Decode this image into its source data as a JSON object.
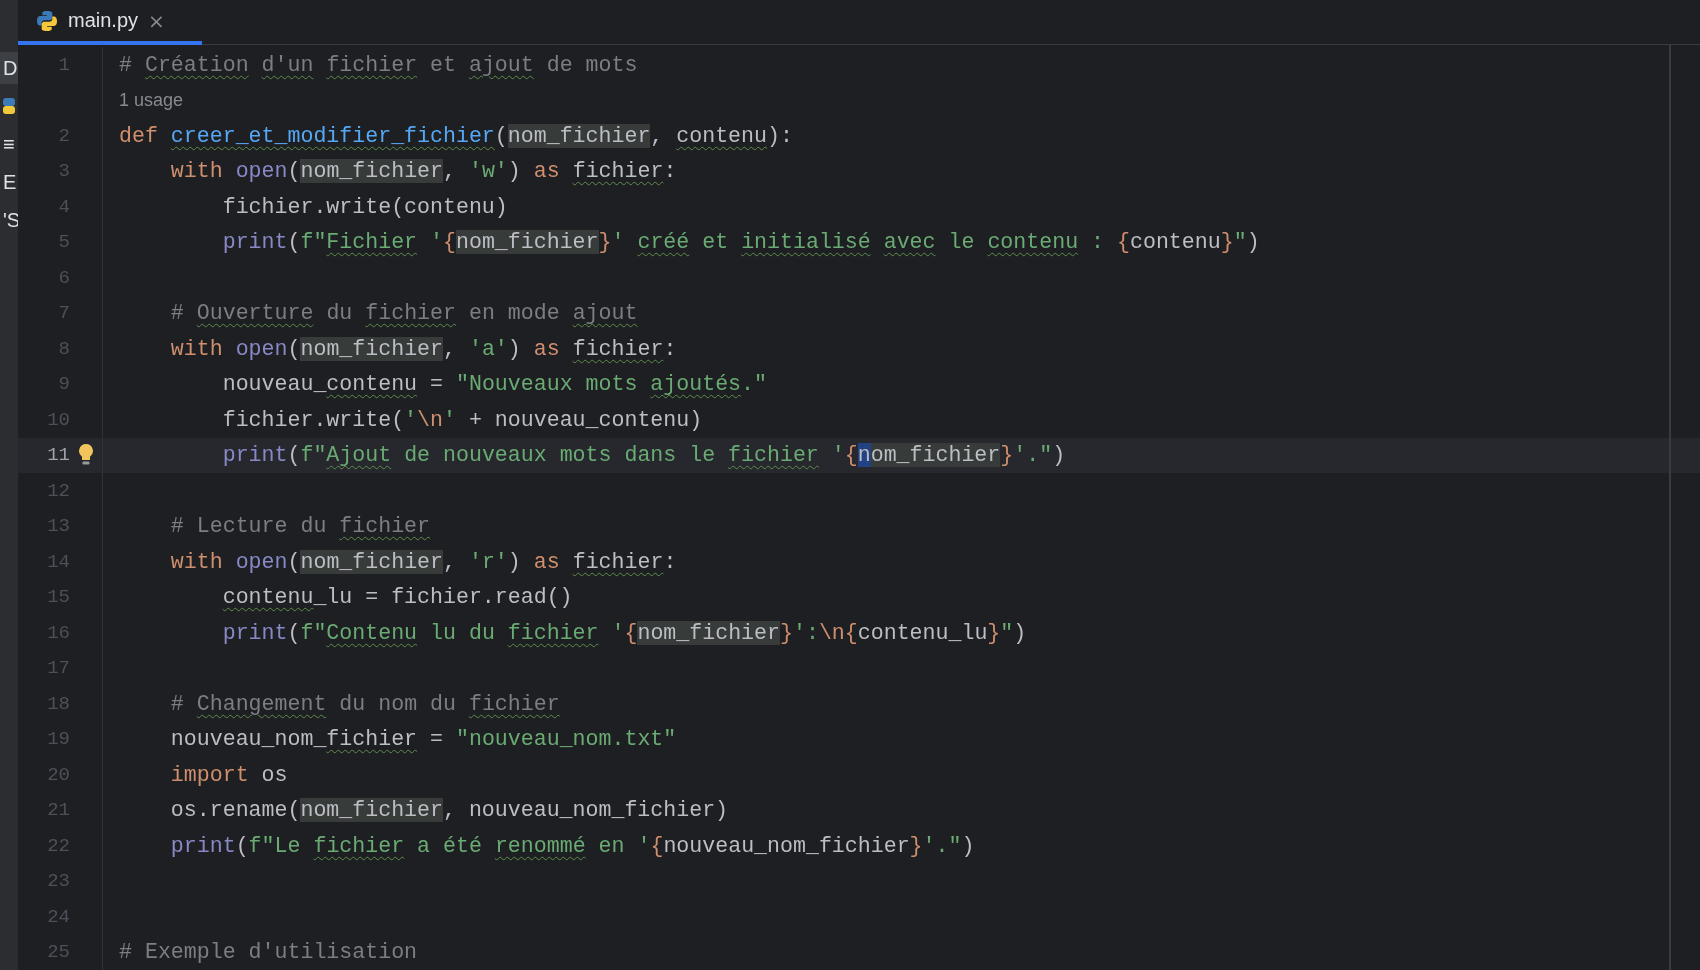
{
  "side_strip": [
    {
      "kind": "text",
      "text": "D",
      "selected": true
    },
    {
      "kind": "python-icon",
      "selected": false
    },
    {
      "kind": "text",
      "text": "≡",
      "selected": false
    },
    {
      "kind": "text",
      "text": "E",
      "selected": false
    },
    {
      "kind": "text",
      "text": "'S",
      "selected": false
    }
  ],
  "tabs": [
    {
      "label": "main.py",
      "close": "×",
      "selected": true
    }
  ],
  "rows": [
    {
      "kind": "code",
      "number": "1",
      "current": false,
      "hint": false,
      "tokens": [
        {
          "text": "# ",
          "kind": "comment"
        },
        {
          "text": "Création",
          "kind": "comment",
          "underlined": true
        },
        {
          "text": " d'un",
          "kind": "comment",
          "underlined": true
        },
        {
          "text": " fichier",
          "kind": "comment",
          "underlined": true
        },
        {
          "text": " et",
          "kind": "comment"
        },
        {
          "text": " ajout",
          "kind": "comment",
          "underlined": true
        },
        {
          "text": " de mots",
          "kind": "comment"
        }
      ]
    },
    {
      "kind": "usage",
      "text": "1 usage"
    },
    {
      "kind": "code",
      "number": "2",
      "current": false,
      "hint": false,
      "tokens": [
        {
          "text": "def",
          "kind": "keyword"
        },
        {
          "text": " creer_et_modifier_fichier",
          "kind": "function",
          "underlined": true
        },
        {
          "text": "(",
          "kind": "plain"
        },
        {
          "text": "nom_fichier",
          "kind": "plain",
          "highlighted": true
        },
        {
          "text": ",",
          "kind": "plain"
        },
        {
          "text": " contenu",
          "kind": "plain",
          "underlined": true
        },
        {
          "text": "):",
          "kind": "plain"
        }
      ]
    },
    {
      "kind": "code",
      "number": "3",
      "current": false,
      "hint": false,
      "tokens": [
        {
          "text": "    with",
          "kind": "keyword"
        },
        {
          "text": " open",
          "kind": "builtin"
        },
        {
          "text": "(",
          "kind": "plain"
        },
        {
          "text": "nom_fichier",
          "kind": "plain",
          "highlighted": true
        },
        {
          "text": ",",
          "kind": "plain"
        },
        {
          "text": " 'w'",
          "kind": "string"
        },
        {
          "text": ")",
          "kind": "plain"
        },
        {
          "text": " as",
          "kind": "keyword"
        },
        {
          "text": " fichier",
          "kind": "plain",
          "underlined": true
        },
        {
          "text": ":",
          "kind": "plain"
        }
      ]
    },
    {
      "kind": "code",
      "number": "4",
      "current": false,
      "hint": false,
      "tokens": [
        {
          "text": "        fichier.write(contenu)",
          "kind": "plain"
        }
      ]
    },
    {
      "kind": "code",
      "number": "5",
      "current": false,
      "hint": false,
      "tokens": [
        {
          "text": "        print",
          "kind": "builtin"
        },
        {
          "text": "(",
          "kind": "plain"
        },
        {
          "text": "f\"",
          "kind": "string"
        },
        {
          "text": "Fichier",
          "kind": "string",
          "underlined": true
        },
        {
          "text": " '",
          "kind": "string"
        },
        {
          "text": "{",
          "kind": "brace"
        },
        {
          "text": "nom_fichier",
          "kind": "plain",
          "highlighted": true
        },
        {
          "text": "}",
          "kind": "brace"
        },
        {
          "text": "'",
          "kind": "string"
        },
        {
          "text": " créé",
          "kind": "string",
          "underlined": true
        },
        {
          "text": " et",
          "kind": "string"
        },
        {
          "text": " initialisé",
          "kind": "string",
          "underlined": true
        },
        {
          "text": " avec",
          "kind": "string",
          "underlined": true
        },
        {
          "text": " le",
          "kind": "string"
        },
        {
          "text": " contenu",
          "kind": "string",
          "underlined": true
        },
        {
          "text": " : ",
          "kind": "string"
        },
        {
          "text": "{",
          "kind": "brace"
        },
        {
          "text": "contenu",
          "kind": "plain"
        },
        {
          "text": "}",
          "kind": "brace"
        },
        {
          "text": "\"",
          "kind": "string"
        },
        {
          "text": ")",
          "kind": "plain"
        }
      ]
    },
    {
      "kind": "code",
      "number": "6",
      "current": false,
      "hint": false,
      "tokens": []
    },
    {
      "kind": "code",
      "number": "7",
      "current": false,
      "hint": false,
      "tokens": [
        {
          "text": "    #",
          "kind": "comment"
        },
        {
          "text": " Ouverture",
          "kind": "comment",
          "underlined": true
        },
        {
          "text": " du",
          "kind": "comment"
        },
        {
          "text": " fichier",
          "kind": "comment",
          "underlined": true
        },
        {
          "text": " en mode",
          "kind": "comment"
        },
        {
          "text": " ajout",
          "kind": "comment",
          "underlined": true
        }
      ]
    },
    {
      "kind": "code",
      "number": "8",
      "current": false,
      "hint": false,
      "tokens": [
        {
          "text": "    with",
          "kind": "keyword"
        },
        {
          "text": " open",
          "kind": "builtin"
        },
        {
          "text": "(",
          "kind": "plain"
        },
        {
          "text": "nom_fichier",
          "kind": "plain",
          "highlighted": true
        },
        {
          "text": ",",
          "kind": "plain"
        },
        {
          "text": " 'a'",
          "kind": "string"
        },
        {
          "text": ")",
          "kind": "plain"
        },
        {
          "text": " as",
          "kind": "keyword"
        },
        {
          "text": " fichier",
          "kind": "plain",
          "underlined": true
        },
        {
          "text": ":",
          "kind": "plain"
        }
      ]
    },
    {
      "kind": "code",
      "number": "9",
      "current": false,
      "hint": false,
      "tokens": [
        {
          "text": "        nouveau_",
          "kind": "plain"
        },
        {
          "text": "contenu",
          "kind": "plain",
          "underlined": true
        },
        {
          "text": " =",
          "kind": "plain"
        },
        {
          "text": " \"Nouveaux mots",
          "kind": "string"
        },
        {
          "text": " ajoutés",
          "kind": "string",
          "underlined": true
        },
        {
          "text": ".\"",
          "kind": "string"
        }
      ]
    },
    {
      "kind": "code",
      "number": "10",
      "current": false,
      "hint": false,
      "tokens": [
        {
          "text": "        fichier.write(",
          "kind": "plain"
        },
        {
          "text": "'",
          "kind": "string"
        },
        {
          "text": "\\n",
          "kind": "brace"
        },
        {
          "text": "'",
          "kind": "string"
        },
        {
          "text": " + nouveau_contenu)",
          "kind": "plain"
        }
      ]
    },
    {
      "kind": "code",
      "number": "11",
      "current": true,
      "hint": true,
      "tokens": [
        {
          "text": "        print",
          "kind": "builtin"
        },
        {
          "text": "(",
          "kind": "plain"
        },
        {
          "text": "f\"",
          "kind": "string"
        },
        {
          "text": "Ajout",
          "kind": "string",
          "underlined": true
        },
        {
          "text": " de nouveaux mots dans le",
          "kind": "string"
        },
        {
          "text": " fichier",
          "kind": "string",
          "underlined": true
        },
        {
          "text": " '",
          "kind": "string"
        },
        {
          "text": "{",
          "kind": "brace"
        },
        {
          "text": "n",
          "kind": "plain",
          "selected": true
        },
        {
          "text": "om_fichier",
          "kind": "plain",
          "highlighted": true
        },
        {
          "text": "}",
          "kind": "brace"
        },
        {
          "text": "'.\"",
          "kind": "string"
        },
        {
          "text": ")",
          "kind": "plain"
        }
      ]
    },
    {
      "kind": "code",
      "number": "12",
      "current": false,
      "hint": false,
      "tokens": []
    },
    {
      "kind": "code",
      "number": "13",
      "current": false,
      "hint": false,
      "tokens": [
        {
          "text": "    # Lecture du",
          "kind": "comment"
        },
        {
          "text": " fichier",
          "kind": "comment",
          "underlined": true
        }
      ]
    },
    {
      "kind": "code",
      "number": "14",
      "current": false,
      "hint": false,
      "tokens": [
        {
          "text": "    with",
          "kind": "keyword"
        },
        {
          "text": " open",
          "kind": "builtin"
        },
        {
          "text": "(",
          "kind": "plain"
        },
        {
          "text": "nom_fichier",
          "kind": "plain",
          "highlighted": true
        },
        {
          "text": ",",
          "kind": "plain"
        },
        {
          "text": " 'r'",
          "kind": "string"
        },
        {
          "text": ")",
          "kind": "plain"
        },
        {
          "text": " as",
          "kind": "keyword"
        },
        {
          "text": " fichier",
          "kind": "plain",
          "underlined": true
        },
        {
          "text": ":",
          "kind": "plain"
        }
      ]
    },
    {
      "kind": "code",
      "number": "15",
      "current": false,
      "hint": false,
      "tokens": [
        {
          "text": "        contenu",
          "kind": "plain",
          "underlined": true
        },
        {
          "text": "_lu = fichier.read()",
          "kind": "plain"
        }
      ]
    },
    {
      "kind": "code",
      "number": "16",
      "current": false,
      "hint": false,
      "tokens": [
        {
          "text": "        print",
          "kind": "builtin"
        },
        {
          "text": "(",
          "kind": "plain"
        },
        {
          "text": "f\"",
          "kind": "string"
        },
        {
          "text": "Contenu",
          "kind": "string",
          "underlined": true
        },
        {
          "text": " lu du",
          "kind": "string"
        },
        {
          "text": " fichier",
          "kind": "string",
          "underlined": true
        },
        {
          "text": " '",
          "kind": "string"
        },
        {
          "text": "{",
          "kind": "brace"
        },
        {
          "text": "nom_fichier",
          "kind": "plain",
          "highlighted": true
        },
        {
          "text": "}",
          "kind": "brace"
        },
        {
          "text": "':",
          "kind": "string"
        },
        {
          "text": "\\n{",
          "kind": "brace"
        },
        {
          "text": "contenu_lu",
          "kind": "plain"
        },
        {
          "text": "}",
          "kind": "brace"
        },
        {
          "text": "\"",
          "kind": "string"
        },
        {
          "text": ")",
          "kind": "plain"
        }
      ]
    },
    {
      "kind": "code",
      "number": "17",
      "current": false,
      "hint": false,
      "tokens": []
    },
    {
      "kind": "code",
      "number": "18",
      "current": false,
      "hint": false,
      "tokens": [
        {
          "text": "    #",
          "kind": "comment"
        },
        {
          "text": " Changement",
          "kind": "comment",
          "underlined": true
        },
        {
          "text": " du nom du",
          "kind": "comment"
        },
        {
          "text": " fichier",
          "kind": "comment",
          "underlined": true
        }
      ]
    },
    {
      "kind": "code",
      "number": "19",
      "current": false,
      "hint": false,
      "tokens": [
        {
          "text": "    nouveau_nom_",
          "kind": "plain"
        },
        {
          "text": "fichier",
          "kind": "plain",
          "underlined": true
        },
        {
          "text": " =",
          "kind": "plain"
        },
        {
          "text": " \"nouveau_nom.txt\"",
          "kind": "string"
        }
      ]
    },
    {
      "kind": "code",
      "number": "20",
      "current": false,
      "hint": false,
      "tokens": [
        {
          "text": "    import",
          "kind": "keyword"
        },
        {
          "text": " os",
          "kind": "plain"
        }
      ]
    },
    {
      "kind": "code",
      "number": "21",
      "current": false,
      "hint": false,
      "tokens": [
        {
          "text": "    os.rename(",
          "kind": "plain"
        },
        {
          "text": "nom_fichier",
          "kind": "plain",
          "highlighted": true
        },
        {
          "text": ", nouveau_nom_fichier)",
          "kind": "plain"
        }
      ]
    },
    {
      "kind": "code",
      "number": "22",
      "current": false,
      "hint": false,
      "tokens": [
        {
          "text": "    print",
          "kind": "builtin"
        },
        {
          "text": "(",
          "kind": "plain"
        },
        {
          "text": "f\"Le",
          "kind": "string"
        },
        {
          "text": " fichier",
          "kind": "string",
          "underlined": true
        },
        {
          "text": " a été",
          "kind": "string"
        },
        {
          "text": " renommé",
          "kind": "string",
          "underlined": true
        },
        {
          "text": " en '",
          "kind": "string"
        },
        {
          "text": "{",
          "kind": "brace"
        },
        {
          "text": "nouveau_nom_fichier",
          "kind": "plain"
        },
        {
          "text": "}",
          "kind": "brace"
        },
        {
          "text": "'.\"",
          "kind": "string"
        },
        {
          "text": ")",
          "kind": "plain"
        }
      ]
    },
    {
      "kind": "code",
      "number": "23",
      "current": false,
      "hint": false,
      "tokens": []
    },
    {
      "kind": "code",
      "number": "24",
      "current": false,
      "hint": false,
      "tokens": []
    },
    {
      "kind": "code",
      "number": "25",
      "current": false,
      "hint": false,
      "tokens": [
        {
          "text": "# Exemple d'utilisation",
          "kind": "comment"
        }
      ]
    }
  ]
}
